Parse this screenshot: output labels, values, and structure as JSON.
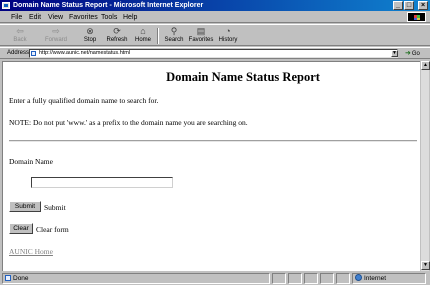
{
  "window": {
    "title": "Domain Name Status Report - Microsoft Internet Explorer",
    "minimize": "_",
    "maximize": "□",
    "close": "×"
  },
  "menu": [
    "File",
    "Edit",
    "View",
    "Favorites",
    "Tools",
    "Help"
  ],
  "toolbar": {
    "back": "Back",
    "forward": "Forward",
    "stop": "Stop",
    "refresh": "Refresh",
    "home": "Home",
    "search": "Search",
    "favorites": "Favorites",
    "history": "History"
  },
  "address": {
    "label": "Address",
    "url": "http://www.aunic.net/namestatus.html",
    "go": "Go"
  },
  "page": {
    "title": "Domain Name Status Report",
    "intro": "Enter a fully qualified domain name to search for.",
    "note": "NOTE: Do not put 'www.' as a prefix to the domain name you are searching on.",
    "domain_label": "Domain Name",
    "domain_value": "",
    "submit_button": "Submit",
    "submit_text": "Submit",
    "clear_button": "Clear",
    "clear_text": "Clear form",
    "home_link": "AUNIC Home"
  },
  "status": {
    "text": "Done",
    "zone": "Internet"
  }
}
